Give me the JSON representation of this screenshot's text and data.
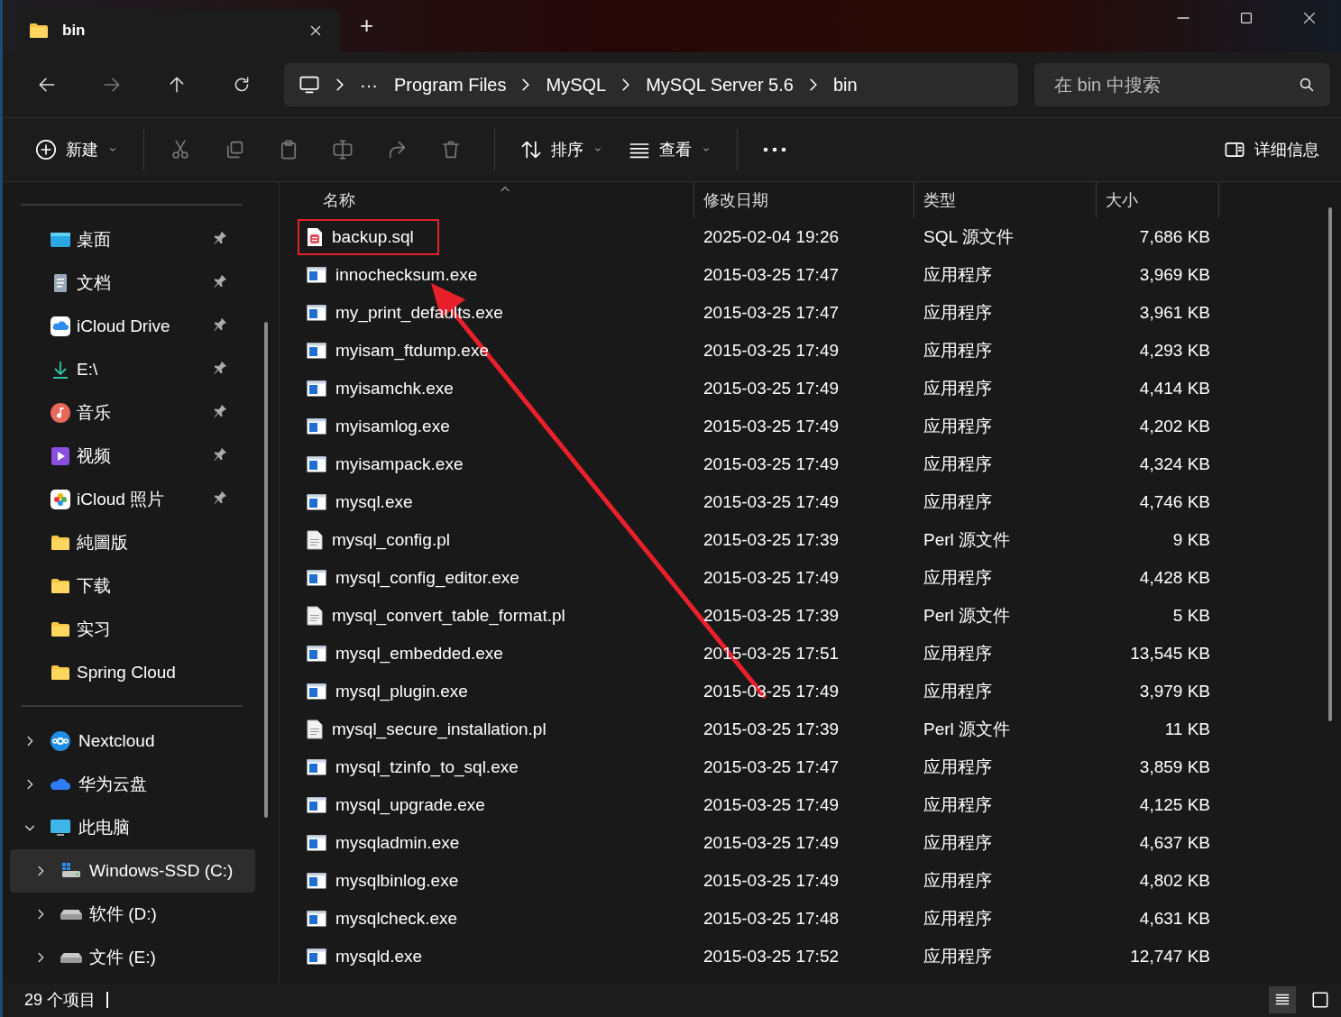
{
  "window": {
    "tab_title": "bin",
    "new_tab": "+"
  },
  "address": {
    "overflow": "···",
    "segments": [
      "Program Files",
      "MySQL",
      "MySQL Server 5.6",
      "bin"
    ],
    "search_placeholder": "在 bin 中搜索"
  },
  "toolbar": {
    "new": "新建",
    "sort": "排序",
    "view": "查看",
    "details": "详细信息"
  },
  "sidebar": {
    "quick": [
      {
        "label": "桌面",
        "kind": "desktop",
        "pinned": true
      },
      {
        "label": "文档",
        "kind": "document",
        "pinned": true
      },
      {
        "label": "iCloud Drive",
        "kind": "cloud",
        "pinned": true
      },
      {
        "label": "E:\\",
        "kind": "download",
        "pinned": true
      },
      {
        "label": "音乐",
        "kind": "music",
        "pinned": true
      },
      {
        "label": "视频",
        "kind": "video",
        "pinned": true
      },
      {
        "label": "iCloud 照片",
        "kind": "photos",
        "pinned": true
      },
      {
        "label": "純圖版",
        "kind": "folder",
        "pinned": false
      },
      {
        "label": "下载",
        "kind": "folder",
        "pinned": false
      },
      {
        "label": "实习",
        "kind": "folder",
        "pinned": false
      },
      {
        "label": "Spring Cloud",
        "kind": "folder",
        "pinned": false
      }
    ],
    "tree": [
      {
        "label": "Nextcloud",
        "kind": "nextcloud",
        "expanded": false,
        "selected": false
      },
      {
        "label": "华为云盘",
        "kind": "huawei",
        "expanded": false,
        "selected": false
      },
      {
        "label": "此电脑",
        "kind": "pc",
        "expanded": true,
        "selected": false,
        "children": [
          {
            "label": "Windows-SSD (C:)",
            "kind": "windrive",
            "expanded": false,
            "selected": true
          },
          {
            "label": "软件 (D:)",
            "kind": "drive",
            "expanded": false,
            "selected": false
          },
          {
            "label": "文件 (E:)",
            "kind": "drive",
            "expanded": false,
            "selected": false
          }
        ]
      }
    ]
  },
  "columns": [
    "名称",
    "修改日期",
    "类型",
    "大小"
  ],
  "files": [
    {
      "name": "backup.sql",
      "date": "2025-02-04 19:26",
      "type": "SQL 源文件",
      "size": "7,686 KB",
      "kind": "sql",
      "annotated": true
    },
    {
      "name": "innochecksum.exe",
      "date": "2015-03-25 17:47",
      "type": "应用程序",
      "size": "3,969 KB",
      "kind": "exe",
      "annotated": false
    },
    {
      "name": "my_print_defaults.exe",
      "date": "2015-03-25 17:47",
      "type": "应用程序",
      "size": "3,961 KB",
      "kind": "exe",
      "annotated": false
    },
    {
      "name": "myisam_ftdump.exe",
      "date": "2015-03-25 17:49",
      "type": "应用程序",
      "size": "4,293 KB",
      "kind": "exe",
      "annotated": false
    },
    {
      "name": "myisamchk.exe",
      "date": "2015-03-25 17:49",
      "type": "应用程序",
      "size": "4,414 KB",
      "kind": "exe",
      "annotated": false
    },
    {
      "name": "myisamlog.exe",
      "date": "2015-03-25 17:49",
      "type": "应用程序",
      "size": "4,202 KB",
      "kind": "exe",
      "annotated": false
    },
    {
      "name": "myisampack.exe",
      "date": "2015-03-25 17:49",
      "type": "应用程序",
      "size": "4,324 KB",
      "kind": "exe",
      "annotated": false
    },
    {
      "name": "mysql.exe",
      "date": "2015-03-25 17:49",
      "type": "应用程序",
      "size": "4,746 KB",
      "kind": "exe",
      "annotated": false
    },
    {
      "name": "mysql_config.pl",
      "date": "2015-03-25 17:39",
      "type": "Perl 源文件",
      "size": "9 KB",
      "kind": "pl",
      "annotated": false
    },
    {
      "name": "mysql_config_editor.exe",
      "date": "2015-03-25 17:49",
      "type": "应用程序",
      "size": "4,428 KB",
      "kind": "exe",
      "annotated": false
    },
    {
      "name": "mysql_convert_table_format.pl",
      "date": "2015-03-25 17:39",
      "type": "Perl 源文件",
      "size": "5 KB",
      "kind": "pl",
      "annotated": false
    },
    {
      "name": "mysql_embedded.exe",
      "date": "2015-03-25 17:51",
      "type": "应用程序",
      "size": "13,545 KB",
      "kind": "exe",
      "annotated": false
    },
    {
      "name": "mysql_plugin.exe",
      "date": "2015-03-25 17:49",
      "type": "应用程序",
      "size": "3,979 KB",
      "kind": "exe",
      "annotated": false
    },
    {
      "name": "mysql_secure_installation.pl",
      "date": "2015-03-25 17:39",
      "type": "Perl 源文件",
      "size": "11 KB",
      "kind": "pl",
      "annotated": false
    },
    {
      "name": "mysql_tzinfo_to_sql.exe",
      "date": "2015-03-25 17:47",
      "type": "应用程序",
      "size": "3,859 KB",
      "kind": "exe",
      "annotated": false
    },
    {
      "name": "mysql_upgrade.exe",
      "date": "2015-03-25 17:49",
      "type": "应用程序",
      "size": "4,125 KB",
      "kind": "exe",
      "annotated": false
    },
    {
      "name": "mysqladmin.exe",
      "date": "2015-03-25 17:49",
      "type": "应用程序",
      "size": "4,637 KB",
      "kind": "exe",
      "annotated": false
    },
    {
      "name": "mysqlbinlog.exe",
      "date": "2015-03-25 17:49",
      "type": "应用程序",
      "size": "4,802 KB",
      "kind": "exe",
      "annotated": false
    },
    {
      "name": "mysqlcheck.exe",
      "date": "2015-03-25 17:48",
      "type": "应用程序",
      "size": "4,631 KB",
      "kind": "exe",
      "annotated": false
    },
    {
      "name": "mysqld.exe",
      "date": "2015-03-25 17:52",
      "type": "应用程序",
      "size": "12,747 KB",
      "kind": "exe",
      "annotated": false
    }
  ],
  "status": {
    "count": "29 个项目",
    "views": [
      {
        "kind": "details",
        "selected": true
      },
      {
        "kind": "tiles",
        "selected": false
      }
    ]
  }
}
